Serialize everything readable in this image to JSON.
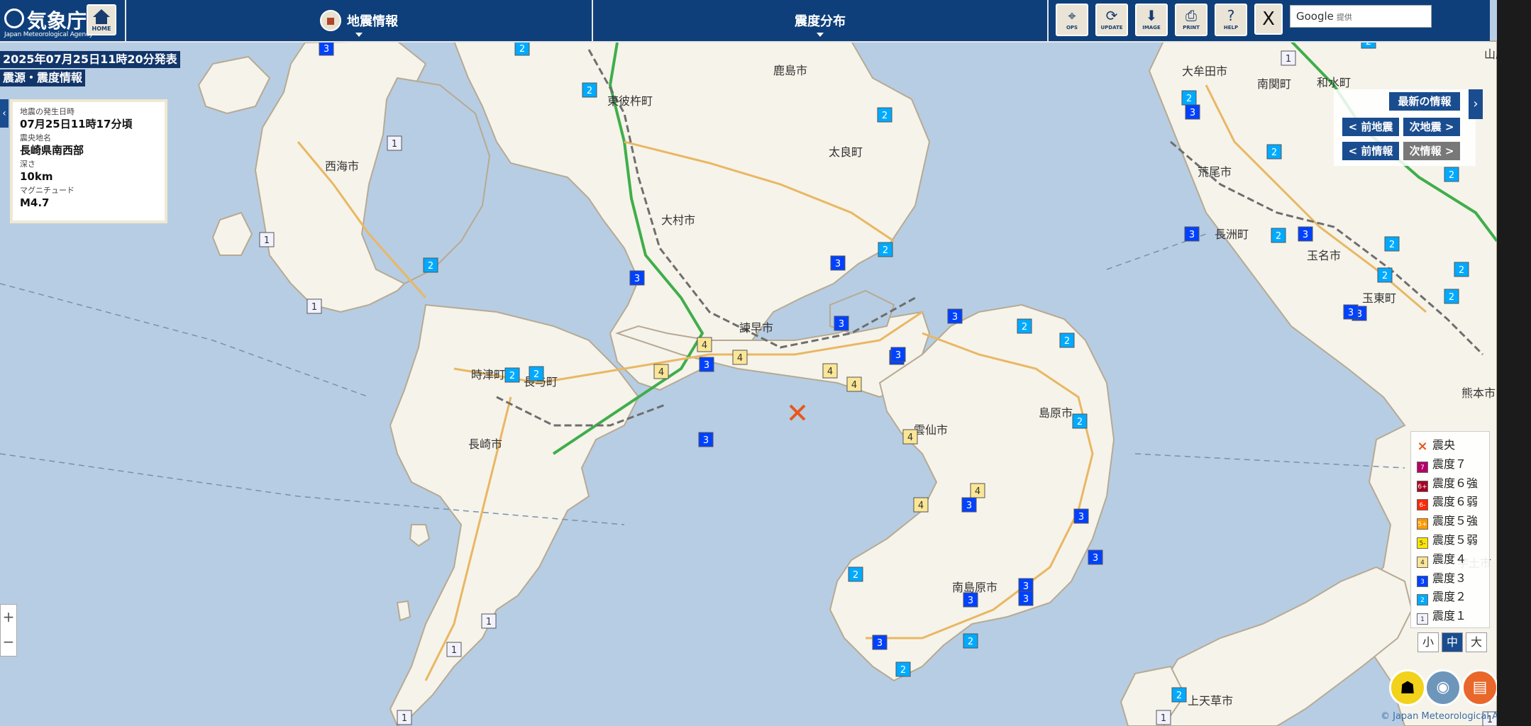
{
  "header": {
    "logo_text": "気象庁",
    "logo_sub": "Japan Meteorological Agency",
    "home_label": "HOME",
    "tab_quake": "地震情報",
    "tab_dist": "震度分布",
    "tools": [
      {
        "label": "OPS",
        "icon": "crosshair-icon"
      },
      {
        "label": "UPDATE",
        "icon": "refresh-icon"
      },
      {
        "label": "IMAGE",
        "icon": "download-icon"
      },
      {
        "label": "PRINT",
        "icon": "printer-icon"
      },
      {
        "label": "HELP",
        "icon": "help-icon"
      }
    ],
    "x_label": "X",
    "search_brand": "Google",
    "search_suffix": "提供"
  },
  "issue": {
    "line1": "2025年07月25日11時20分発表",
    "line2": "震源・震度情報"
  },
  "info": {
    "time_label": "地震の発生日時",
    "time_value": "07月25日11時17分頃",
    "place_label": "震央地名",
    "place_value": "長崎県南西部",
    "depth_label": "深さ",
    "depth_value": "10km",
    "mag_label": "マグニチュード",
    "mag_value": "M4.7"
  },
  "nav": {
    "latest": "最新の情報",
    "prev_quake": "< 前地震",
    "next_quake": "次地震 >",
    "prev_info": "< 前情報",
    "next_info": "次情報 >"
  },
  "legend": [
    {
      "label": "震央",
      "badge": "×",
      "color": "#e8571a",
      "kind": "epicenter"
    },
    {
      "label": "震度７",
      "badge": "7",
      "color": "#b40068"
    },
    {
      "label": "震度６強",
      "badge": "6+",
      "color": "#a50021"
    },
    {
      "label": "震度６弱",
      "badge": "6-",
      "color": "#ff2800"
    },
    {
      "label": "震度５強",
      "badge": "5+",
      "color": "#ff9900"
    },
    {
      "label": "震度５弱",
      "badge": "5-",
      "color": "#ffe600"
    },
    {
      "label": "震度４",
      "badge": "4",
      "color": "#fae696"
    },
    {
      "label": "震度３",
      "badge": "3",
      "color": "#0041ff"
    },
    {
      "label": "震度２",
      "badge": "2",
      "color": "#00aaff"
    },
    {
      "label": "震度１",
      "badge": "1",
      "color": "#f2f2ff"
    }
  ],
  "sizes": [
    "小",
    "中",
    "大"
  ],
  "copyright": "© Japan Meteorological Agency",
  "map": {
    "colors": {
      "sea": "#b7cde3",
      "land": "#f6f3ea",
      "coast": "#b6aa93",
      "road": "#e9b763",
      "rail": "#6e6e6e",
      "expressway": "#3fae4b"
    },
    "cities": [
      {
        "name": "鹿島市"
      },
      {
        "name": "東彼杵町"
      },
      {
        "name": "太良町"
      },
      {
        "name": "大村市"
      },
      {
        "name": "西海市"
      },
      {
        "name": "諫早市"
      },
      {
        "name": "時津町"
      },
      {
        "name": "長与町"
      },
      {
        "name": "長崎市"
      },
      {
        "name": "雲仙市"
      },
      {
        "name": "島原市"
      },
      {
        "name": "南島原市"
      },
      {
        "name": "大牟田市"
      },
      {
        "name": "南関町"
      },
      {
        "name": "和水町"
      },
      {
        "name": "荒尾市"
      },
      {
        "name": "長洲町"
      },
      {
        "name": "玉名市"
      },
      {
        "name": "玉東町"
      },
      {
        "name": "熊本市"
      },
      {
        "name": "宇土市"
      },
      {
        "name": "上天草市"
      },
      {
        "name": "山鹿"
      }
    ],
    "stations": [
      {
        "i": "3"
      },
      {
        "i": "2"
      },
      {
        "i": "2"
      },
      {
        "i": "2"
      },
      {
        "i": "3"
      },
      {
        "i": "2"
      },
      {
        "i": "1"
      },
      {
        "i": "1"
      },
      {
        "i": "2"
      },
      {
        "i": "1"
      },
      {
        "i": "3"
      },
      {
        "i": "3"
      },
      {
        "i": "3"
      },
      {
        "i": "4"
      },
      {
        "i": "4"
      },
      {
        "i": "4"
      },
      {
        "i": "4"
      },
      {
        "i": "4"
      },
      {
        "i": "3"
      },
      {
        "i": "3"
      },
      {
        "i": "3"
      },
      {
        "i": "2"
      },
      {
        "i": "2"
      },
      {
        "i": "2"
      },
      {
        "i": "3"
      },
      {
        "i": "2"
      },
      {
        "i": "3"
      },
      {
        "i": "4"
      },
      {
        "i": "4"
      },
      {
        "i": "3"
      },
      {
        "i": "4"
      },
      {
        "i": "3"
      },
      {
        "i": "3"
      },
      {
        "i": "3"
      },
      {
        "i": "2"
      },
      {
        "i": "3"
      },
      {
        "i": "2"
      },
      {
        "i": "3"
      },
      {
        "i": "1"
      },
      {
        "i": "1"
      },
      {
        "i": "2"
      },
      {
        "i": "2"
      },
      {
        "i": "1"
      },
      {
        "i": "2"
      },
      {
        "i": "1"
      },
      {
        "i": "2"
      },
      {
        "i": "3"
      },
      {
        "i": "2"
      },
      {
        "i": "3"
      },
      {
        "i": "2"
      },
      {
        "i": "3"
      },
      {
        "i": "2"
      },
      {
        "i": "2"
      },
      {
        "i": "2"
      },
      {
        "i": "3"
      },
      {
        "i": "2"
      },
      {
        "i": "2"
      },
      {
        "i": "3"
      },
      {
        "i": "2"
      },
      {
        "i": "1"
      },
      {
        "i": "1"
      }
    ]
  }
}
